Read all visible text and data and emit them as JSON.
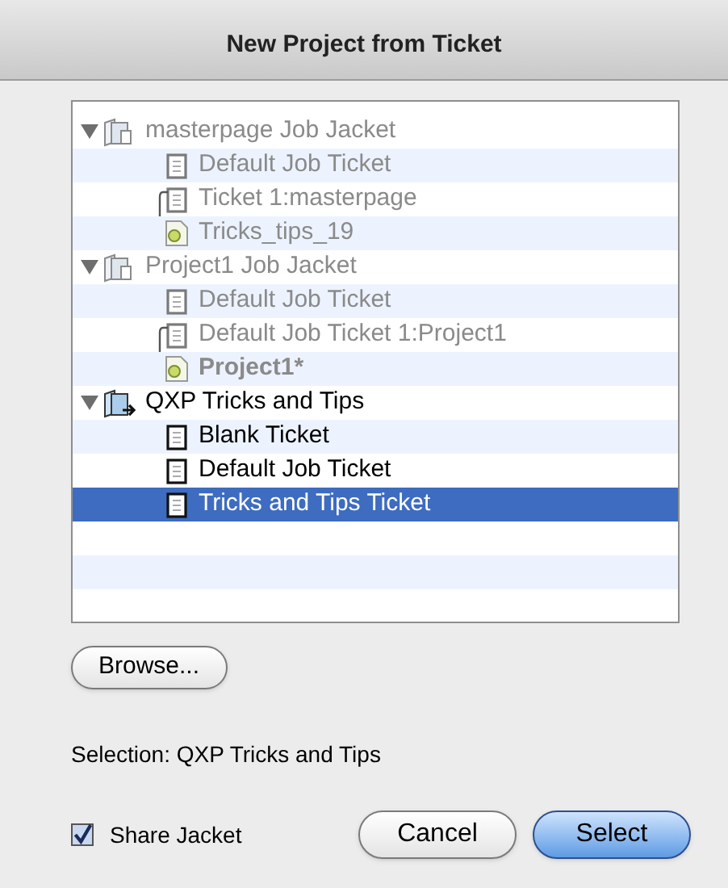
{
  "window": {
    "title": "New Project from Ticket"
  },
  "tree": [
    {
      "label": "masterpage Job Jacket",
      "kind": "jacket",
      "expanded": true,
      "disabled": true,
      "selected": false,
      "children": [
        {
          "label": "Default Job Ticket",
          "kind": "ticket",
          "bold": false,
          "selected": false
        },
        {
          "label": "Ticket 1:masterpage",
          "kind": "linked-ticket",
          "bold": false,
          "selected": false
        },
        {
          "label": "Tricks_tips_19",
          "kind": "project",
          "bold": false,
          "selected": false
        }
      ]
    },
    {
      "label": "Project1 Job Jacket",
      "kind": "jacket",
      "expanded": true,
      "disabled": true,
      "selected": false,
      "children": [
        {
          "label": "Default Job Ticket",
          "kind": "ticket",
          "bold": false,
          "selected": false
        },
        {
          "label": "Default Job Ticket 1:Project1",
          "kind": "linked-ticket",
          "bold": false,
          "selected": false
        },
        {
          "label": "Project1*",
          "kind": "project",
          "bold": true,
          "selected": false
        }
      ]
    },
    {
      "label": "QXP Tricks and Tips",
      "kind": "shared-jacket",
      "expanded": true,
      "disabled": false,
      "selected": false,
      "children": [
        {
          "label": "Blank Ticket",
          "kind": "ticket",
          "bold": false,
          "selected": false
        },
        {
          "label": "Default Job Ticket",
          "kind": "ticket",
          "bold": false,
          "selected": false
        },
        {
          "label": "Tricks and Tips Ticket",
          "kind": "ticket",
          "bold": false,
          "selected": true
        }
      ]
    }
  ],
  "browse_button": "Browse...",
  "selection": "Selection: QXP Tricks and Tips",
  "share_jacket": {
    "label": "Share Jacket",
    "checked": true
  },
  "buttons": [
    {
      "label": "Cancel",
      "kind": "normal"
    },
    {
      "label": "Select",
      "kind": "default"
    }
  ]
}
